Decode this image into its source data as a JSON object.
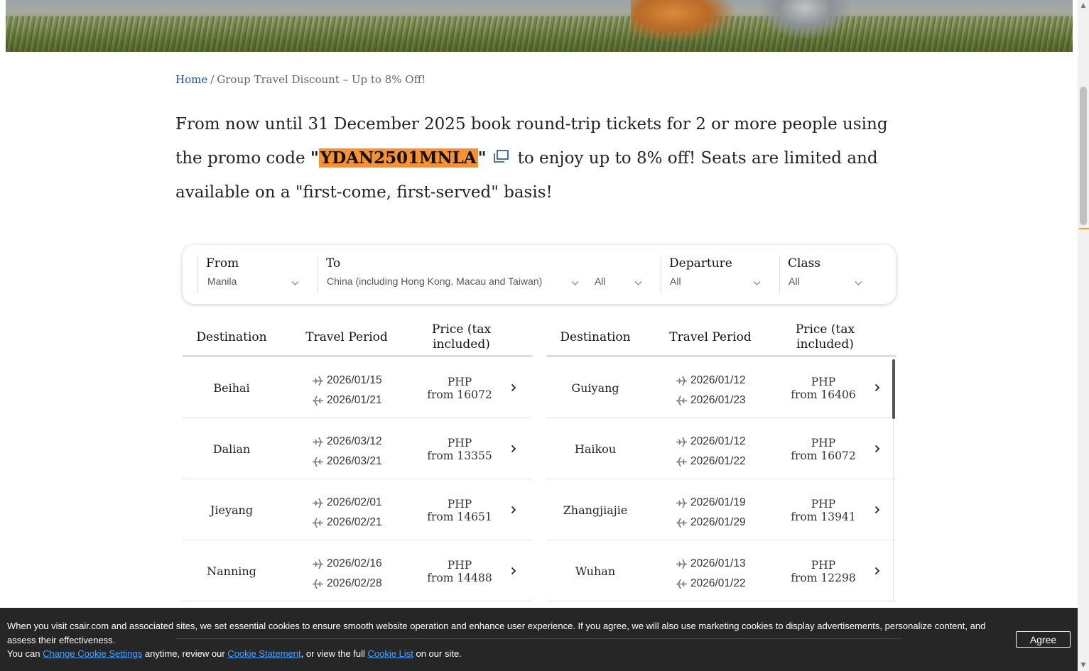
{
  "breadcrumb": {
    "home": "Home",
    "separator": "/",
    "current": "Group Travel Discount – Up to 8% Off!"
  },
  "promo": {
    "text_before": "From now until 31 December 2025 book round-trip tickets for 2 or more people using the promo code",
    "quote_open": "\"",
    "code": "YDAN2501MNLA",
    "quote_close": "\"",
    "text_after": "to enjoy up to 8% off! Seats are limited and available on a \"first-come, first-served\" basis!",
    "copy_icon": "copy-icon"
  },
  "filters": {
    "from": {
      "label": "From",
      "value": "Manila"
    },
    "to": {
      "label": "To",
      "value": "China (including Hong Kong, Macau and Taiwan)",
      "sub_value": "All"
    },
    "departure": {
      "label": "Departure",
      "value": "All"
    },
    "class": {
      "label": "Class",
      "value": "All"
    }
  },
  "table": {
    "headers": {
      "destination": "Destination",
      "travel_period": "Travel Period",
      "price": "Price (tax included)"
    },
    "left": [
      {
        "destination": "Beihai",
        "depart": "2026/01/15",
        "return": "2026/01/21",
        "currency": "PHP",
        "price": "from 16072"
      },
      {
        "destination": "Dalian",
        "depart": "2026/03/12",
        "return": "2026/03/21",
        "currency": "PHP",
        "price": "from 13355"
      },
      {
        "destination": "Jieyang",
        "depart": "2026/02/01",
        "return": "2026/02/21",
        "currency": "PHP",
        "price": "from 14651"
      },
      {
        "destination": "Nanning",
        "depart": "2026/02/16",
        "return": "2026/02/28",
        "currency": "PHP",
        "price": "from 14488"
      }
    ],
    "right": [
      {
        "destination": "Guiyang",
        "depart": "2026/01/12",
        "return": "2026/01/23",
        "currency": "PHP",
        "price": "from 16406"
      },
      {
        "destination": "Haikou",
        "depart": "2026/01/12",
        "return": "2026/01/22",
        "currency": "PHP",
        "price": "from 16072"
      },
      {
        "destination": "Zhangjiajie",
        "depart": "2026/01/19",
        "return": "2026/01/29",
        "currency": "PHP",
        "price": "from 13941"
      },
      {
        "destination": "Wuhan",
        "depart": "2026/01/13",
        "return": "2026/01/22",
        "currency": "PHP",
        "price": "from 12298"
      }
    ]
  },
  "cookie": {
    "line1": "When you visit csair.com and associated sites, we set essential cookies to ensure smooth website operation and enhance user experience. If you agree, we will also use marketing cookies to display advertisements, personalize content, and assess their effectiveness.",
    "line2_a": "You can ",
    "link_settings": "Change Cookie Settings",
    "line2_b": " anytime, review our ",
    "link_statement": "Cookie Statement",
    "line2_c": ", or view the full ",
    "link_list": "Cookie List",
    "line2_d": " on our site.",
    "agree": "Agree"
  },
  "colors": {
    "promo_code_highlight": "#f79234",
    "link": "#1d4f91",
    "cookie_link": "#4aa3ff",
    "cookie_bg": "#161616"
  }
}
